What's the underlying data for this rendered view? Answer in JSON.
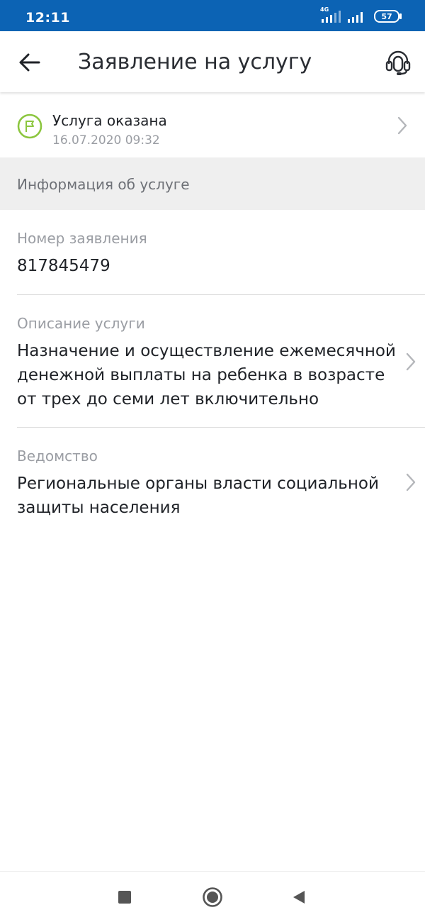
{
  "status_bar": {
    "time": "12:11",
    "network": "4G",
    "battery": "57"
  },
  "header": {
    "title": "Заявление на услугу",
    "back_icon": "arrow-left-icon",
    "support_icon": "headset-icon"
  },
  "service_status": {
    "title": "Услуга оказана",
    "date": "16.07.2020 09:32",
    "icon": "flag-icon",
    "accent_color": "#8cc63f"
  },
  "section": {
    "title": "Информация об услуге"
  },
  "fields": {
    "application_number": {
      "label": "Номер заявления",
      "value": "817845479"
    },
    "description": {
      "label": "Описание услуги",
      "lines": [
        "Назначение и осуществление ежемесячной",
        "денежной выплаты на ребенка в возрасте",
        "от трех до семи лет включительно"
      ]
    },
    "department": {
      "label": "Ведомство",
      "lines": [
        "Региональные органы власти социальной",
        "защиты населения"
      ]
    }
  },
  "colors": {
    "status_bar": "#0c63b4",
    "section_background": "#efefef"
  }
}
